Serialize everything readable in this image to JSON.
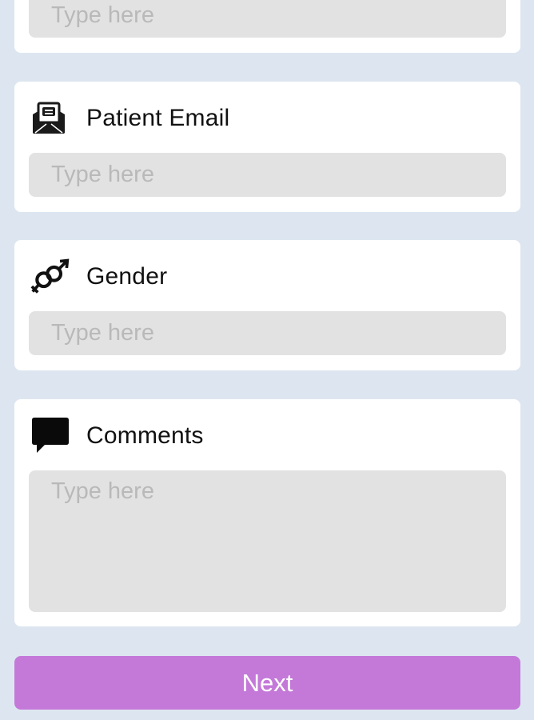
{
  "fields": {
    "previous": {
      "placeholder": "Type here",
      "value": ""
    },
    "email": {
      "label": "Patient Email",
      "placeholder": "Type here",
      "value": "",
      "icon": "envelope-icon"
    },
    "gender": {
      "label": "Gender",
      "placeholder": "Type here",
      "value": "",
      "icon": "gender-icon"
    },
    "comments": {
      "label": "Comments",
      "placeholder": "Type here",
      "value": "",
      "icon": "speech-bubble-icon"
    }
  },
  "next_label": "Next",
  "colors": {
    "background": "#dde6f0",
    "card": "#ffffff",
    "field": "#e2e2e2",
    "placeholder": "#b9b9b9",
    "button": "#c479d9"
  }
}
